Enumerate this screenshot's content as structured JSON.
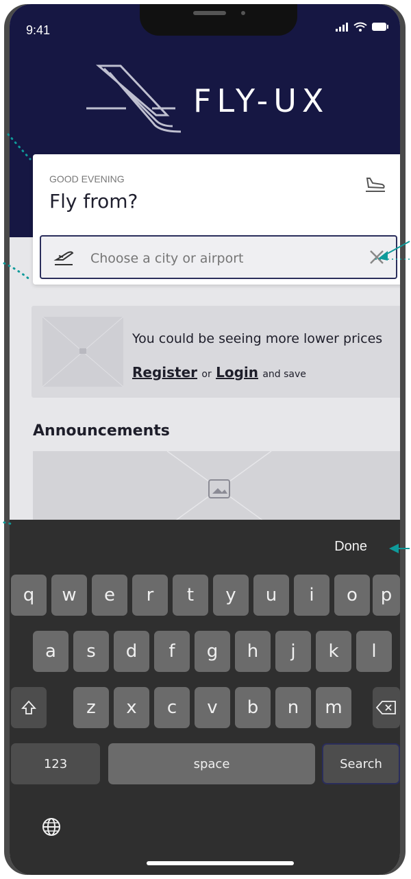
{
  "status": {
    "time": "9:41"
  },
  "header": {
    "brand": "FLY-UX"
  },
  "card": {
    "greeting": "GOOD EVENING",
    "title": "Fly from?",
    "search_placeholder": "Choose a city or airport"
  },
  "promo": {
    "text": "You could be seeing more lower prices",
    "register": "Register",
    "or": "or",
    "login": "Login",
    "save": "and save"
  },
  "announcements": {
    "title": "Announcements"
  },
  "keyboard": {
    "done": "Done",
    "row1": [
      "q",
      "w",
      "e",
      "r",
      "t",
      "y",
      "u",
      "i",
      "o",
      "p"
    ],
    "row2": [
      "a",
      "s",
      "d",
      "f",
      "g",
      "h",
      "j",
      "k",
      "l"
    ],
    "row3": [
      "z",
      "x",
      "c",
      "v",
      "b",
      "n",
      "m"
    ],
    "numbers": "123",
    "space": "space",
    "search": "Search"
  },
  "colors": {
    "header_bg": "#161743",
    "accent_teal": "#0f9a9a",
    "search_border": "#2a2d5b",
    "keyboard_bg": "#2f2f2f"
  }
}
